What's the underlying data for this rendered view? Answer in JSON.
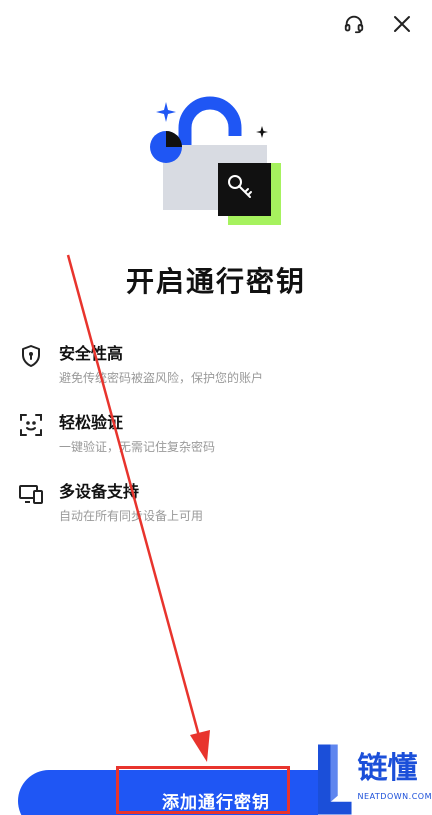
{
  "header": {
    "support_icon": "headset-icon",
    "close_icon": "close-icon"
  },
  "hero": {
    "icon": "padlock-key-illustration",
    "accent": "#1f56f4",
    "green": "#a6f25e"
  },
  "title": "开启通行密钥",
  "features": [
    {
      "icon": "shield-icon",
      "title": "安全性高",
      "desc": "避免传统密码被盗风险，保护您的账户"
    },
    {
      "icon": "face-scan-icon",
      "title": "轻松验证",
      "desc": "一键验证，无需记住复杂密码"
    },
    {
      "icon": "devices-icon",
      "title": "多设备支持",
      "desc": "自动在所有同步设备上可用"
    }
  ],
  "primary_button": {
    "label": "添加通行密钥",
    "color": "#1f56f4"
  },
  "watermark": {
    "text": "链懂",
    "subtext": "NEATDOWN.COM"
  },
  "annotation": {
    "color": "#e8342d"
  }
}
